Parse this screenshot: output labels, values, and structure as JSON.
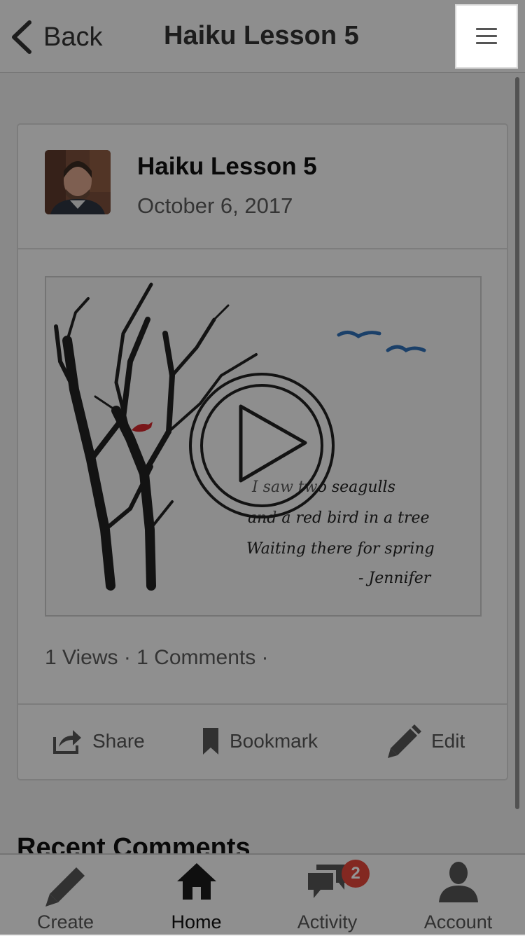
{
  "header": {
    "back_label": "Back",
    "title": "Haiku Lesson 5",
    "menu_icon": "hamburger-menu-icon"
  },
  "post": {
    "title": "Haiku Lesson 5",
    "date": "October 6, 2017",
    "stats": "1 Views · 1 Comments ·",
    "video": {
      "poem_lines": [
        "I saw two seagulls",
        "and a red bird in a tree",
        "Waiting there for spring",
        "- Jennifer"
      ]
    },
    "actions": {
      "share_label": "Share",
      "bookmark_label": "Bookmark",
      "edit_label": "Edit"
    }
  },
  "recent_comments_heading": "Recent Comments",
  "tabbar": {
    "tabs": [
      {
        "label": "Create",
        "icon": "pencil-icon"
      },
      {
        "label": "Home",
        "icon": "home-icon"
      },
      {
        "label": "Activity",
        "icon": "chat-bubbles-icon"
      },
      {
        "label": "Account",
        "icon": "person-icon"
      }
    ],
    "active_tab": "Home",
    "activity_badge": "2"
  },
  "colors": {
    "badge": "#e2453a",
    "overlay": "rgba(0,0,0,0.42)",
    "seagull": "#2f6fb5",
    "red_bird": "#d0262b"
  }
}
